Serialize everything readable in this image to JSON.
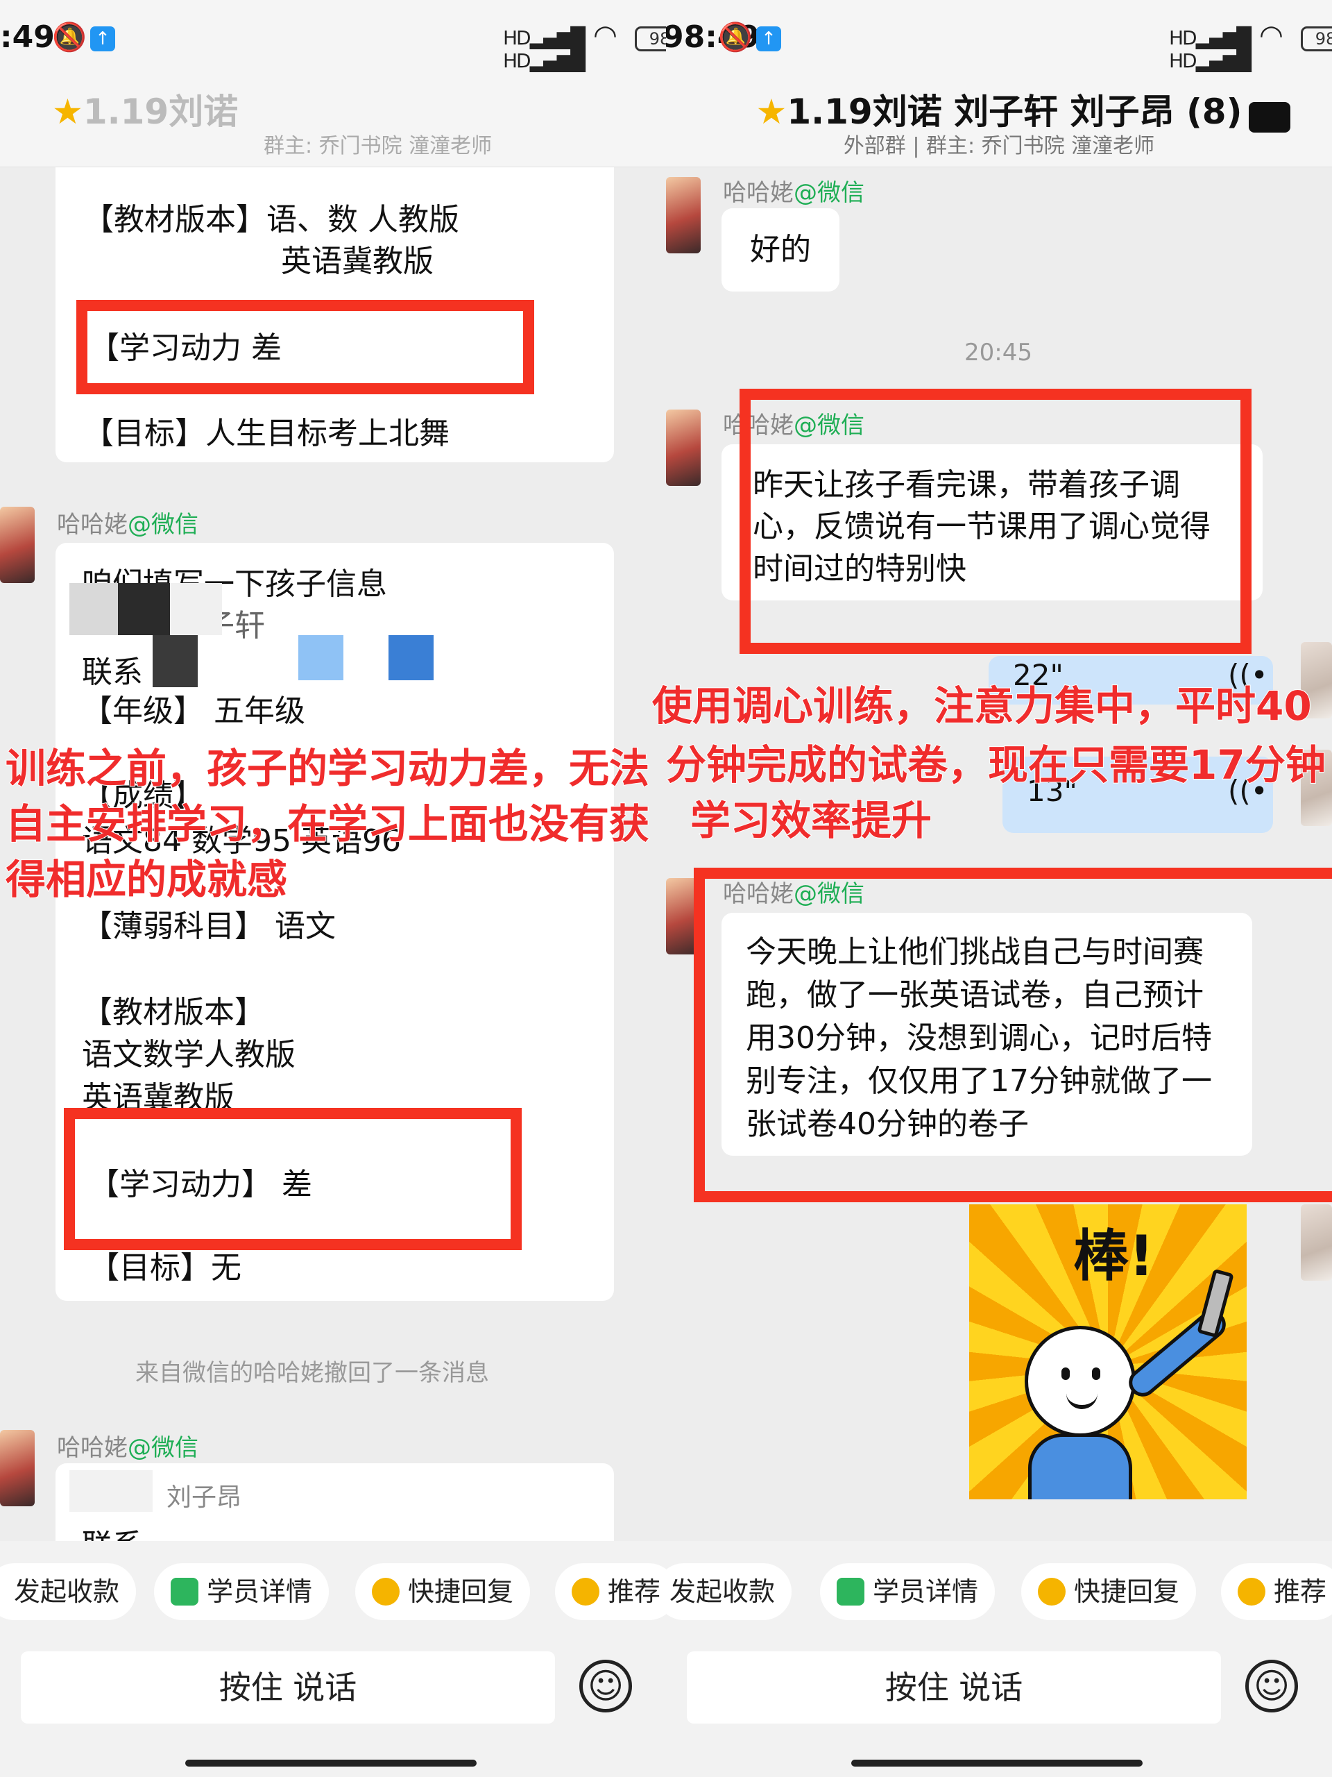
{
  "left": {
    "status": {
      "time": ":49",
      "battery": "98"
    },
    "header": {
      "title": "1.19刘诺",
      "subtitle": "群主: 乔门书院 潼潼老师"
    },
    "card1": {
      "textbook": "【教材版本】语、数 人教版",
      "textbook2": "英语冀教版",
      "motivation": "【学习动力      差",
      "goal": "【目标】人生目标考上北舞"
    },
    "sender": {
      "name": "哈哈姥",
      "tag": "@微信"
    },
    "card2": {
      "intro": "咱们填写一下孩子信息",
      "name_partial": "刘子轩",
      "contact_partial": "联系",
      "grade": "【年级】 五年级",
      "scores_label": "【成绩】",
      "scores": "语文84    数学95     英语96",
      "weak": "【薄弱科目】 语文",
      "textbook_label": "【教材版本】",
      "textbook_a": "语文数学人教版",
      "textbook_b": "英语冀教版",
      "motivation": "【学习动力】    差",
      "goal": "【目标】无"
    },
    "recall_notice": "来自微信的哈哈姥撤回了一条消息",
    "card3": {
      "name_partial": "刘子昂",
      "contact_partial": "联系"
    },
    "overlay": [
      "训练之前，孩子的学习动力差，无法",
      "自主安排学习，在学习上面也没有获",
      "得相应的成就感"
    ],
    "quick": [
      "发起收款",
      "学员详情",
      "快捷回复",
      "推荐"
    ],
    "hold_to_talk": "按住 说话"
  },
  "right": {
    "status": {
      "time": "98:49",
      "battery": "98"
    },
    "header": {
      "title": "1.19刘诺 刘子轩 刘子昂 (8)",
      "subtitle": "外部群 | 群主: 乔门书院 潼潼老师"
    },
    "sender": {
      "name": "哈哈姥",
      "tag": "@微信"
    },
    "msg_ok": "好的",
    "time_sep": "20:45",
    "msg_feedback": [
      "昨天让孩子看完课，带着孩子调",
      "心，反馈说有一节课用了调心觉得",
      "时间过的特别快"
    ],
    "voice": [
      {
        "duration": "22\""
      },
      {
        "duration": "13\""
      }
    ],
    "msg_challenge": [
      "今天晚上让他们挑战自己与时间赛",
      "跑，做了一张英语试卷，自己预计",
      "用30分钟，没想到调心，记时后特",
      "别专注，仅仅用了17分钟就做了一",
      "张试卷40分钟的卷子"
    ],
    "sticker_text": "棒!",
    "overlay": [
      "使用调心训练，注意力集中，平时40",
      "分钟完成的试卷，现在只需要17分钟",
      "学习效率提升"
    ],
    "quick": [
      "推荐",
      "发起收款",
      "学员详情",
      "快捷回复",
      "推荐"
    ],
    "hold_to_talk": "按住 说话"
  },
  "colors": {
    "highlight_red": "#f53221",
    "overlay_red": "#f02c2c",
    "wechat_green": "#1fae55",
    "voice_bubble": "#cde4fb"
  }
}
